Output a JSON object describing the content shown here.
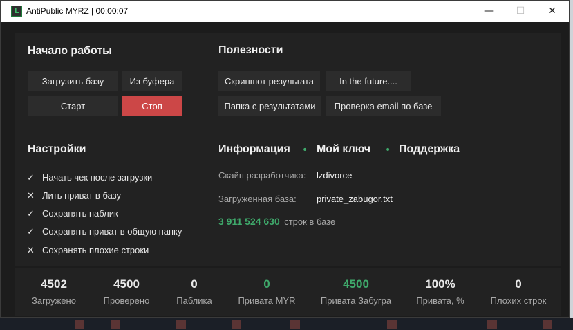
{
  "titlebar": {
    "title": "AntiPublic MYRZ | 00:00:07",
    "icon": "L",
    "minimize": "—",
    "maximize": "☐",
    "close": "✕"
  },
  "start": {
    "heading": "Начало работы",
    "load_base": "Загрузить базу",
    "from_buffer": "Из буфера",
    "start": "Старт",
    "stop": "Стоп"
  },
  "useful": {
    "heading": "Полезности",
    "screenshot": "Скриншот результата",
    "future": "In the future....",
    "results_folder": "Папка с результатами",
    "check_email": "Проверка email по базе"
  },
  "settings": {
    "heading": "Настройки",
    "options": [
      {
        "mark": "✓",
        "label": "Начать чек после загрузки"
      },
      {
        "mark": "✕",
        "label": "Лить приват в базу"
      },
      {
        "mark": "✓",
        "label": "Сохранять паблик"
      },
      {
        "mark": "✓",
        "label": "Сохранять приват в общую папку"
      },
      {
        "mark": "✕",
        "label": "Сохранять плохие строки"
      }
    ]
  },
  "info": {
    "tab_info": "Информация",
    "tab_key": "Мой ключ",
    "tab_support": "Поддержка",
    "dot": "•",
    "skype_label": "Скайп разработчика:",
    "skype_value": "lzdivorce",
    "base_label": "Загруженная база:",
    "base_value": "private_zabugor.txt",
    "lines_count": "3 911 524 630",
    "lines_suffix": "строк в базе"
  },
  "stats": [
    {
      "value": "4502",
      "label": "Загружено"
    },
    {
      "value": "4500",
      "label": "Проверено"
    },
    {
      "value": "0",
      "label": "Паблика"
    },
    {
      "value": "0",
      "label": "Привата MYR"
    },
    {
      "value": "4500",
      "label": "Привата Забугра"
    },
    {
      "value": "100%",
      "label": "Привата, %"
    },
    {
      "value": "0",
      "label": "Плохих строк"
    }
  ],
  "colors": {
    "accent_green": "#3fa96b",
    "stop_red": "#cc4747"
  }
}
